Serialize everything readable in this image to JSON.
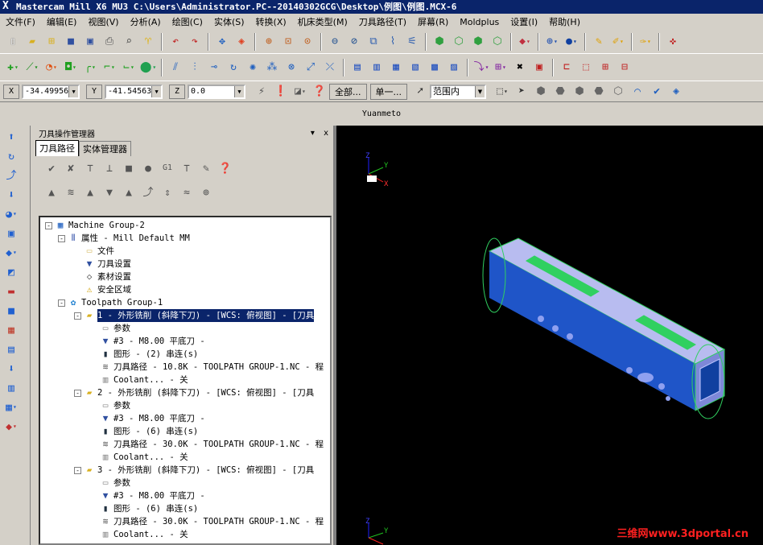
{
  "window": {
    "title": "Mastercam Mill X6 MU3  C:\\Users\\Administrator.PC--20140302GCG\\Desktop\\例图\\例图.MCX-6",
    "logo": "X"
  },
  "menu": [
    "文件(F)",
    "编辑(E)",
    "视图(V)",
    "分析(A)",
    "绘图(C)",
    "实体(S)",
    "转换(X)",
    "机床类型(M)",
    "刀具路径(T)",
    "屏幕(R)",
    "Moldplus",
    "设置(I)",
    "帮助(H)"
  ],
  "coords": {
    "x_label": "X",
    "x_value": "-34.49956",
    "y_label": "Y",
    "y_value": "-41.54563",
    "z_label": "Z",
    "z_value": "0.0",
    "all_button": "全部...",
    "single_button": "单一...",
    "range_value": "范围内"
  },
  "status_name": "Yuanmeto",
  "panel": {
    "title": "刀具操作管理器",
    "pin": "▾",
    "close": "x",
    "tabs": [
      "刀具路径",
      "实体管理器"
    ]
  },
  "tree": [
    {
      "text": "Machine Group-2"
    },
    {
      "text": "属性 - Mill Default MM"
    },
    {
      "text": "文件"
    },
    {
      "text": "刀具设置"
    },
    {
      "text": "素材设置"
    },
    {
      "text": "安全区域"
    },
    {
      "text": "Toolpath Group-1"
    },
    {
      "text": "1 - 外形铣削 (斜降下刀) - [WCS: 俯视图] - [刀具"
    },
    {
      "text": "参数"
    },
    {
      "text": "#3 - M8.00 平底刀 -"
    },
    {
      "text": "图形 - (2) 串连(s)"
    },
    {
      "text": "刀具路径 - 10.8K - TOOLPATH GROUP-1.NC - 程"
    },
    {
      "text": "Coolant... - 关"
    },
    {
      "text": "2 - 外形铣削 (斜降下刀) - [WCS: 俯视图] - [刀具"
    },
    {
      "text": "参数"
    },
    {
      "text": "#3 - M8.00 平底刀 -"
    },
    {
      "text": "图形 - (6) 串连(s)"
    },
    {
      "text": "刀具路径 - 30.0K - TOOLPATH GROUP-1.NC - 程"
    },
    {
      "text": "Coolant... - 关"
    },
    {
      "text": "3 - 外形铣削 (斜降下刀) - [WCS: 俯视图] - [刀具"
    },
    {
      "text": "参数"
    },
    {
      "text": "#3 - M8.00 平底刀 -"
    },
    {
      "text": "图形 - (6) 串连(s)"
    },
    {
      "text": "刀具路径 - 30.0K - TOOLPATH GROUP-1.NC - 程"
    },
    {
      "text": "Coolant... - 关"
    }
  ],
  "viewport": {
    "axis_z": "Z",
    "axis_y": "Y",
    "axis_x": "X",
    "watermark": "三维网www.3dportal.cn",
    "part_color": "#1f55c8",
    "top_face_color": "#b4b8f0",
    "slot_color": "#30d060",
    "background": "#000000"
  },
  "colors": {
    "title_bg": "#0a246a",
    "selection_bg": "#0a246a"
  }
}
